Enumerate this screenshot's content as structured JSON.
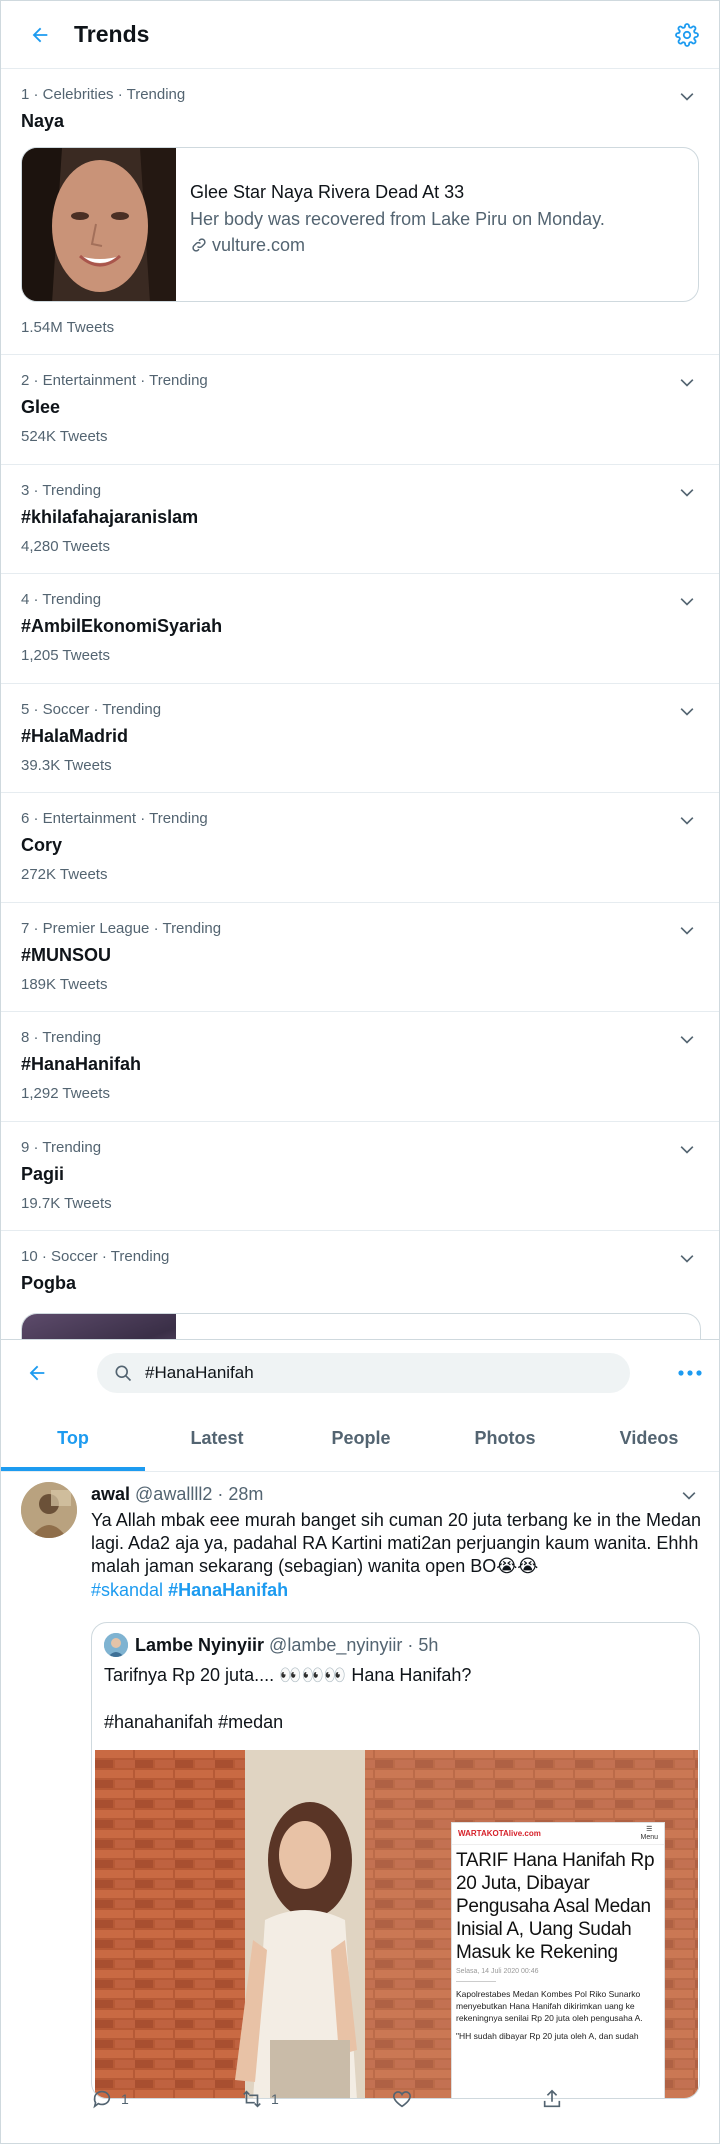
{
  "trends_header": {
    "title": "Trends"
  },
  "trends": [
    {
      "meta": "1 · Celebrities · Trending",
      "name": "Naya",
      "count": "1.54M Tweets",
      "news": {
        "title": "Glee Star Naya Rivera Dead At 33",
        "description": "Her body was recovered from Lake Piru on Monday.",
        "link": "vulture.com"
      }
    },
    {
      "meta": "2 · Entertainment · Trending",
      "name": "Glee",
      "count": "524K Tweets"
    },
    {
      "meta": "3 · Trending",
      "name": "#khilafahajaranislam",
      "count": "4,280 Tweets"
    },
    {
      "meta": "4 · Trending",
      "name": "#AmbilEkonomiSyariah",
      "count": "1,205 Tweets"
    },
    {
      "meta": "5 · Soccer · Trending",
      "name": "#HalaMadrid",
      "count": "39.3K Tweets"
    },
    {
      "meta": "6 · Entertainment · Trending",
      "name": "Cory",
      "count": "272K Tweets"
    },
    {
      "meta": "7 · Premier League · Trending",
      "name": "#MUNSOU",
      "count": "189K Tweets"
    },
    {
      "meta": "8 · Trending",
      "name": "#HanaHanifah",
      "count": "1,292 Tweets"
    },
    {
      "meta": "9 · Trending",
      "name": "Pagii",
      "count": "19.7K Tweets"
    },
    {
      "meta": "10 · Soccer · Trending",
      "name": "Pogba"
    }
  ],
  "search": {
    "query": "#HanaHanifah",
    "tabs": [
      "Top",
      "Latest",
      "People",
      "Photos",
      "Videos"
    ],
    "active_tab": "Top"
  },
  "tweet": {
    "name": "awal",
    "handle": "@awallll2 · 28m",
    "text": "Ya Allah mbak eee murah banget sih cuman 20 juta terbang ke in the Medan lagi. Ada2 aja ya, padahal RA Kartini mati2an perjuangin kaum wanita. Ehhh malah jaman sekarang (sebagian) wanita open BO😭😭",
    "tags": [
      "#skandal",
      "#HanaHanifah"
    ],
    "quote": {
      "name": "Lambe Nyinyiir",
      "handle": "@lambe_nyinyiir · 5h",
      "text": "Tarifnya Rp 20 juta.... 👀👀👀 Hana Hanifah?",
      "text2": "#hanahanifah #medan",
      "article": {
        "logo": "WARTAKOTAlive.com",
        "menu": "Menu",
        "title": "TARIF Hana Hanifah Rp 20 Juta, Dibayar Pengusaha Asal Medan Inisial A, Uang Sudah Masuk ke Rekening",
        "date": "Selasa, 14 Juli 2020 00:46",
        "body": "Kapolrestabes Medan Kombes Pol Riko Sunarko menyebutkan Hana Hanifah dikirimkan uang ke rekeningnya senilai Rp 20 juta oleh pengusaha A.",
        "body2": "\"HH sudah dibayar Rp 20 juta oleh A, dan sudah"
      }
    },
    "actions": {
      "reply_count": "1",
      "retweet_count": "1"
    }
  },
  "colors": {
    "accent": "#1d9bf0",
    "secondary_text": "#536471",
    "border": "#e6ecf0"
  }
}
